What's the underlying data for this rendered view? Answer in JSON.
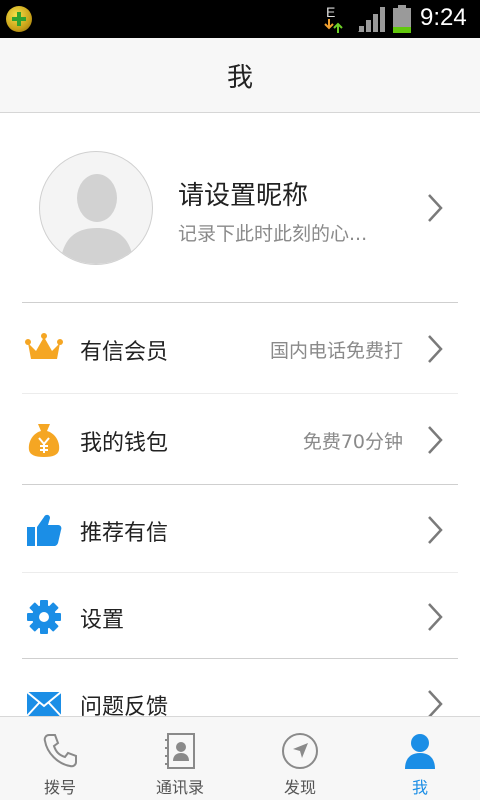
{
  "status_bar": {
    "network": "E",
    "time": "9:24",
    "battery_level": 0.25
  },
  "header": {
    "title": "我"
  },
  "profile": {
    "nickname": "请设置昵称",
    "signature": "记录下此时此刻的心..."
  },
  "menu": [
    {
      "icon": "crown-icon",
      "label": "有信会员",
      "value": "国内电话免费打",
      "icon_color": "#f5a623"
    },
    {
      "icon": "money-bag-icon",
      "label": "我的钱包",
      "value": "免费70分钟",
      "icon_color": "#f5a623"
    },
    {
      "icon": "thumbs-up-icon",
      "label": "推荐有信",
      "value": "",
      "icon_color": "#1b8ee6"
    },
    {
      "icon": "gear-icon",
      "label": "设置",
      "value": "",
      "icon_color": "#1b8ee6"
    },
    {
      "icon": "envelope-icon",
      "label": "问题反馈",
      "value": "",
      "icon_color": "#1b8ee6"
    }
  ],
  "tabs": [
    {
      "icon": "phone-icon",
      "label": "拨号",
      "active": false
    },
    {
      "icon": "contacts-icon",
      "label": "通讯录",
      "active": false
    },
    {
      "icon": "compass-icon",
      "label": "发现",
      "active": false
    },
    {
      "icon": "person-icon",
      "label": "我",
      "active": true
    }
  ],
  "colors": {
    "accent": "#1b8ee6",
    "orange": "#f5a623",
    "muted_text": "#8a8a8a"
  }
}
